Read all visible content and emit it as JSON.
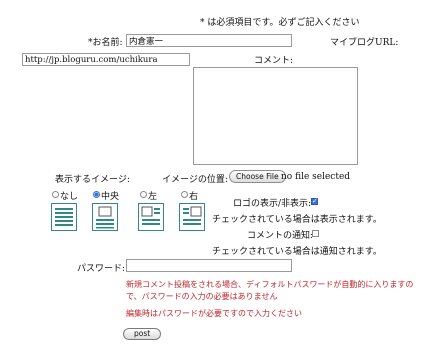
{
  "form": {
    "required_note": "* は必須項目です。必ずご記入ください",
    "name_label": "*お名前:",
    "name_value": "内倉憲一",
    "blog_url_label": "マイブログURL:",
    "blog_url_value": "http://jp.bloguru.com/uchikura",
    "comment_label": "コメント:",
    "comment_value": "",
    "image_display_label": "表示するイメージ:",
    "image_position_label": "イメージの位置:",
    "choose_file_label": "Choose File",
    "no_file_text": "no file selected",
    "image_options": [
      {
        "label": "なし",
        "selected": false
      },
      {
        "label": "中央",
        "selected": true
      },
      {
        "label": "左",
        "selected": false
      },
      {
        "label": "右",
        "selected": false
      }
    ],
    "logo_toggle_label": "ロゴの表示/非表示:",
    "logo_toggle_checked": true,
    "logo_note": "チェックされている場合は表示されます。",
    "comment_notify_label": "コメントの通知:",
    "comment_notify_checked": false,
    "notify_note": "チェックされている場合は通知されます。",
    "password_label": "パスワード:",
    "password_value": "",
    "password_note_line1": "新規コメント投稿をされる場合、ディフォルトパスワードが自動的に入りますの",
    "password_note_line2": "で、パスワードの入力の必要はありません",
    "edit_note": "編集時はパスワードが必要ですので入力ください",
    "post_label": "post"
  },
  "colors": {
    "accent_blue": "#3b6fd0",
    "note_red": "#c0262c",
    "layout_icon_teal": "#2f8a87"
  }
}
